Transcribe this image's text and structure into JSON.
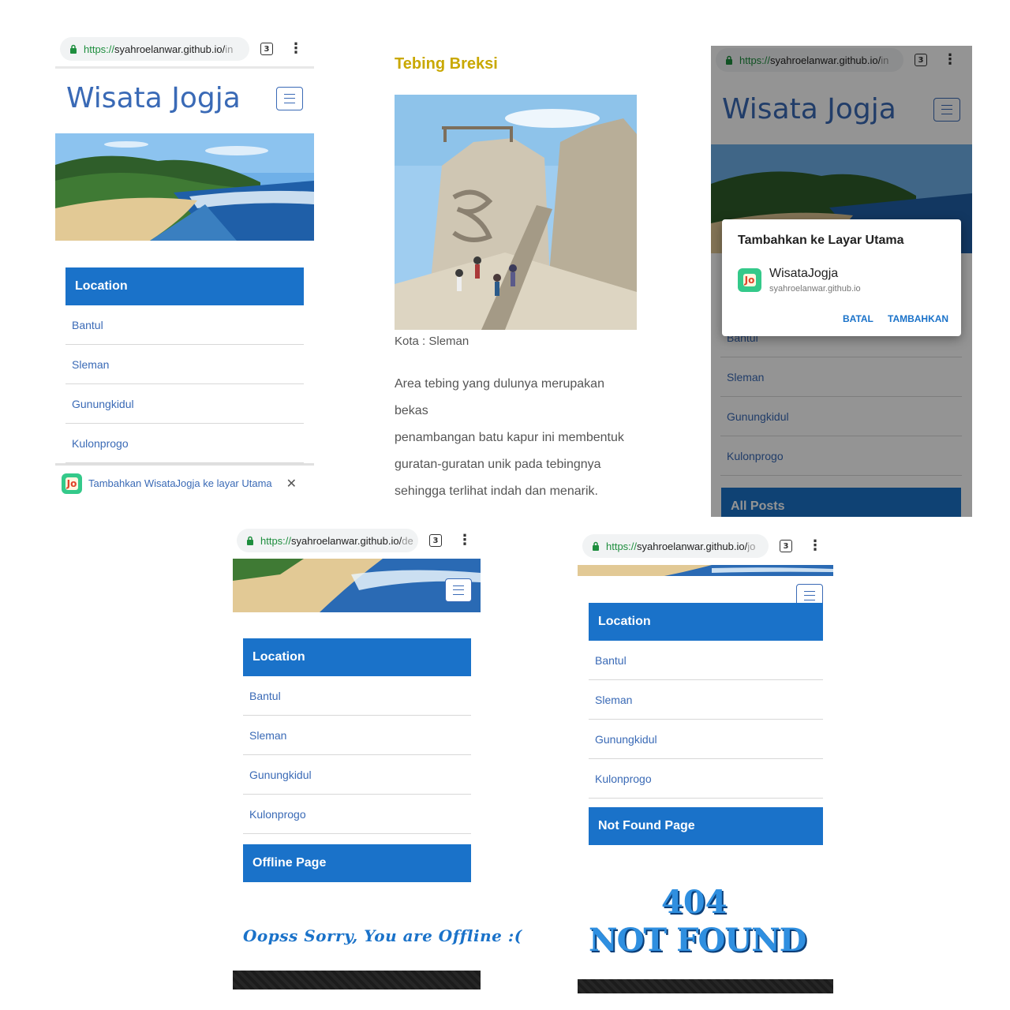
{
  "browser": {
    "url1": {
      "scheme": "https://",
      "host": "syahroelanwar.github.io/",
      "rest": "in"
    },
    "url2": {
      "scheme": "https://",
      "host": "syahroelanwar.github.io/",
      "rest": "in"
    },
    "url3": {
      "scheme": "https://",
      "host": "syahroelanwar.github.io/",
      "rest": "de"
    },
    "url4": {
      "scheme": "https://",
      "host": "syahroelanwar.github.io/",
      "rest": "jo"
    },
    "tab_count": "3",
    "menu_icon": "⋮"
  },
  "site": {
    "title": "Wisata Jogja"
  },
  "location": {
    "header": "Location",
    "items": [
      "Bantul",
      "Sleman",
      "Gunungkidul",
      "Kulonprogo"
    ]
  },
  "install_banner": {
    "text": "Tambahkan WisataJogja ke layar Utama",
    "close": "✕"
  },
  "article": {
    "title": "Tebing Breksi",
    "kota": "Kota : Sleman",
    "lines": [
      "Area tebing yang dulunya merupakan bekas",
      "penambangan batu kapur ini membentuk",
      "guratan-guratan unik pada tebingnya",
      "sehingga terlihat indah dan menarik."
    ]
  },
  "dialog": {
    "title": "Tambahkan ke Layar Utama",
    "app_name": "WisataJogja",
    "app_url": "syahroelanwar.github.io",
    "cancel": "BATAL",
    "add": "TAMBAHKAN",
    "icon_text": "Jo",
    "partial_item": "Bantul"
  },
  "all_posts": "All Posts",
  "offline": {
    "header": "Offline Page",
    "message": "Oopss Sorry, You are Offline :("
  },
  "notfound": {
    "header": "Not Found Page",
    "code": "404",
    "text": "NOT FOUND"
  },
  "colors": {
    "primary_blue": "#1a72c9",
    "title_blue": "#3a6ab6",
    "article_title": "#c9a800"
  }
}
